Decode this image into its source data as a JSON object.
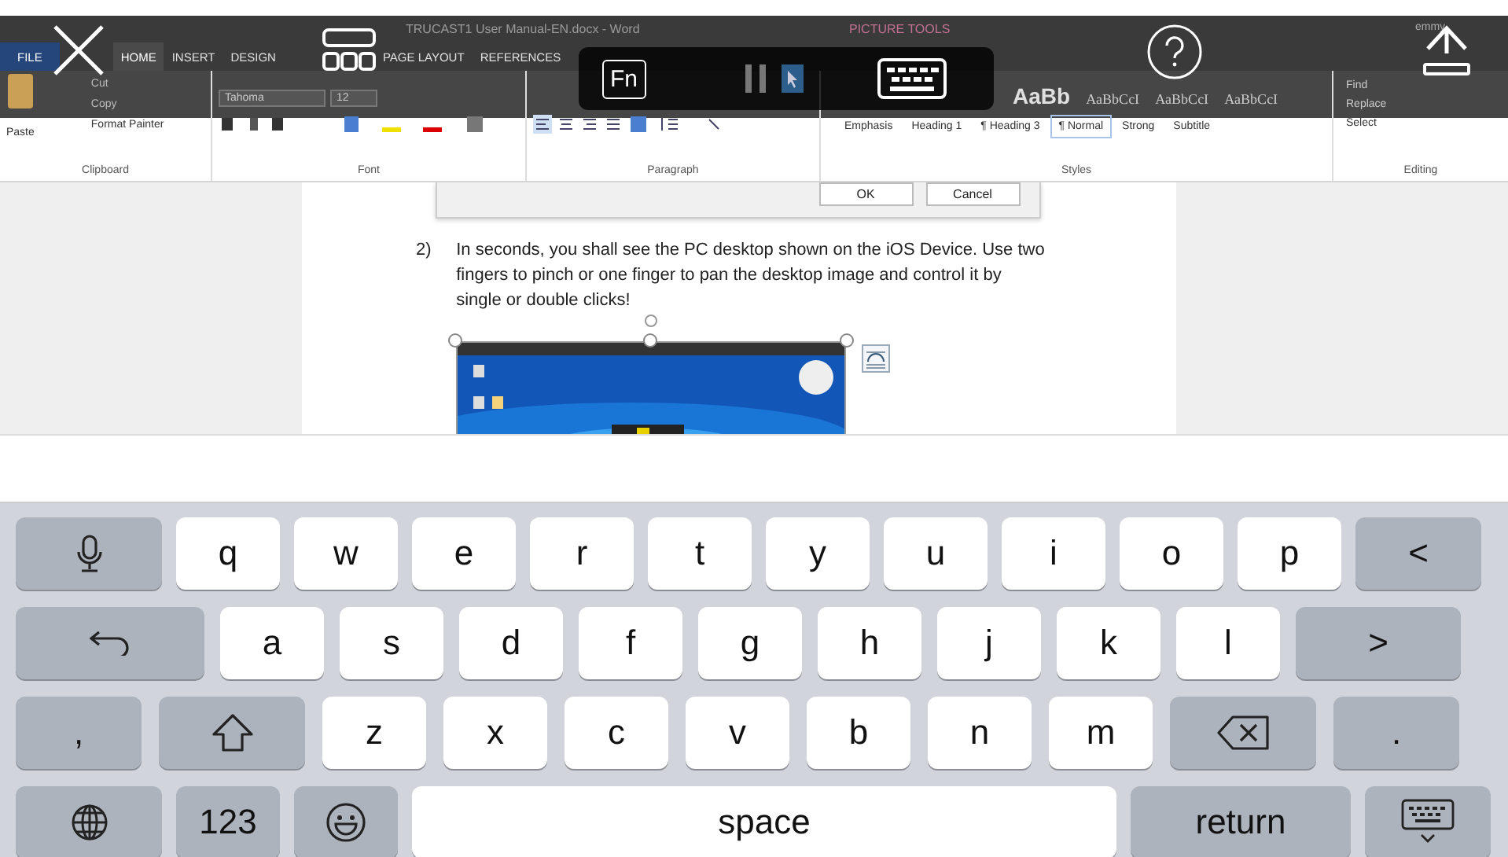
{
  "word_window": {
    "title": "TRUCAST1 User Manual-EN.docx - Word",
    "context_tab": "PICTURE TOOLS",
    "user": "emmy",
    "tabs": [
      {
        "label": "FILE",
        "selected": false
      },
      {
        "label": "HOME",
        "selected": true
      },
      {
        "label": "INSERT",
        "selected": false
      },
      {
        "label": "DESIGN",
        "selected": false
      },
      {
        "label": "PAGE LAYOUT",
        "selected": false
      },
      {
        "label": "REFERENCES",
        "selected": false
      }
    ],
    "clipboard": {
      "paste": "Paste",
      "cut": "Cut",
      "copy": "Copy",
      "format_painter": "Format Painter"
    },
    "font": {
      "name": "Tahoma",
      "size": "12"
    },
    "style_previews": [
      "AaBb",
      "AaBbCcI",
      "AaBbCcI",
      "AaBbCcI"
    ],
    "styles": [
      {
        "label": "Emphasis",
        "selected": false
      },
      {
        "label": "Heading 1",
        "selected": false
      },
      {
        "label": "¶ Heading 3",
        "selected": false
      },
      {
        "label": "¶ Normal",
        "selected": true
      },
      {
        "label": "Strong",
        "selected": false
      },
      {
        "label": "Subtitle",
        "selected": false
      }
    ],
    "editing": [
      "Find",
      "Replace",
      "Select"
    ],
    "groups": [
      "Clipboard",
      "Font",
      "Paragraph",
      "Styles",
      "Editing"
    ]
  },
  "dialog_buttons": [
    "OK",
    "Cancel"
  ],
  "document": {
    "number": "2)",
    "paragraph": "In seconds, you shall see the PC desktop shown on the iOS Device.   Use two fingers to pinch or one finger to pan the desktop image and control it by single or double clicks!"
  },
  "remote_toolbar": {
    "fn_label": "Fn"
  },
  "keyboard": {
    "rows": [
      {
        "keys": [
          {
            "kind": "mic"
          },
          {
            "kind": "letter",
            "label": "q"
          },
          {
            "kind": "letter",
            "label": "w"
          },
          {
            "kind": "letter",
            "label": "e"
          },
          {
            "kind": "letter",
            "label": "r"
          },
          {
            "kind": "letter",
            "label": "t"
          },
          {
            "kind": "letter",
            "label": "y"
          },
          {
            "kind": "letter",
            "label": "u"
          },
          {
            "kind": "letter",
            "label": "i"
          },
          {
            "kind": "letter",
            "label": "o"
          },
          {
            "kind": "letter",
            "label": "p"
          },
          {
            "kind": "char",
            "label": "<"
          }
        ]
      },
      {
        "keys": [
          {
            "kind": "undo"
          },
          {
            "kind": "letter",
            "label": "a"
          },
          {
            "kind": "letter",
            "label": "s"
          },
          {
            "kind": "letter",
            "label": "d"
          },
          {
            "kind": "letter",
            "label": "f"
          },
          {
            "kind": "letter",
            "label": "g"
          },
          {
            "kind": "letter",
            "label": "h"
          },
          {
            "kind": "letter",
            "label": "j"
          },
          {
            "kind": "letter",
            "label": "k"
          },
          {
            "kind": "letter",
            "label": "l"
          },
          {
            "kind": "charwide",
            "label": ">"
          }
        ]
      },
      {
        "keys": [
          {
            "kind": "char",
            "label": ","
          },
          {
            "kind": "shift"
          },
          {
            "kind": "letter",
            "label": "z"
          },
          {
            "kind": "letter",
            "label": "x"
          },
          {
            "kind": "letter",
            "label": "c"
          },
          {
            "kind": "letter",
            "label": "v"
          },
          {
            "kind": "letter",
            "label": "b"
          },
          {
            "kind": "letter",
            "label": "n"
          },
          {
            "kind": "letter",
            "label": "m"
          },
          {
            "kind": "delete"
          },
          {
            "kind": "char",
            "label": "."
          }
        ]
      },
      {
        "keys": [
          {
            "kind": "globe"
          },
          {
            "kind": "numbers",
            "label": "123"
          },
          {
            "kind": "emoji"
          },
          {
            "kind": "space",
            "label": "space"
          },
          {
            "kind": "return",
            "label": "return"
          },
          {
            "kind": "hide"
          }
        ]
      }
    ]
  }
}
